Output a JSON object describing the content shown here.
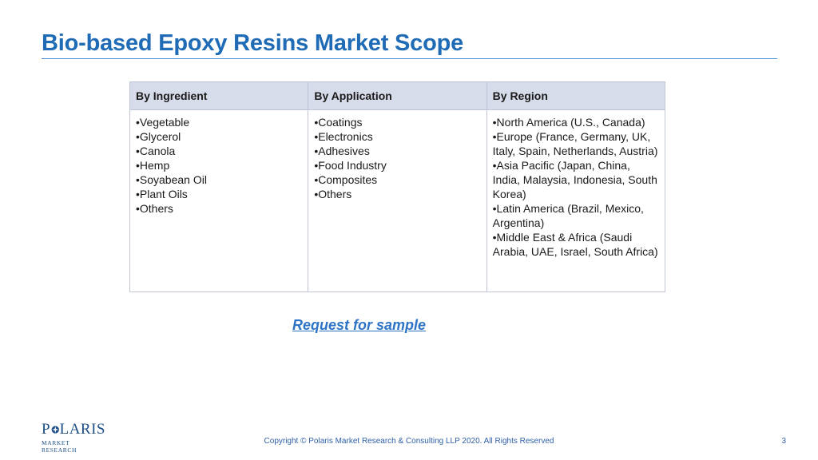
{
  "title": "Bio-based Epoxy Resins Market Scope",
  "table": {
    "headers": [
      "By Ingredient",
      "By Application",
      "By Region"
    ],
    "columns": [
      [
        "•Vegetable",
        "•Glycerol",
        "•Canola",
        "•Hemp",
        "•Soyabean Oil",
        "•Plant Oils",
        "•Others"
      ],
      [
        "•Coatings",
        "•Electronics",
        "•Adhesives",
        "•Food Industry",
        "•Composites",
        "•Others"
      ],
      [
        "•North America (U.S., Canada)",
        "•Europe (France, Germany, UK, Italy, Spain, Netherlands, Austria)",
        "•Asia Pacific (Japan, China, India, Malaysia, Indonesia, South Korea)",
        "•Latin America (Brazil, Mexico, Argentina)",
        "•Middle East & Africa (Saudi Arabia, UAE, Israel, South Africa)"
      ]
    ]
  },
  "link_text": "Request for sample",
  "logo": {
    "wordmark_left": "P",
    "wordmark_right": "LARIS",
    "subtitle": "MARKET RESEARCH"
  },
  "footer": {
    "copyright": "Copyright © Polaris Market Research & Consulting LLP 2020. All Rights Reserved",
    "page_number": "3"
  },
  "colors": {
    "title": "#1f6bb6",
    "header_bg": "#d7dcea",
    "link": "#2e74c6",
    "logo": "#1d4f86"
  }
}
